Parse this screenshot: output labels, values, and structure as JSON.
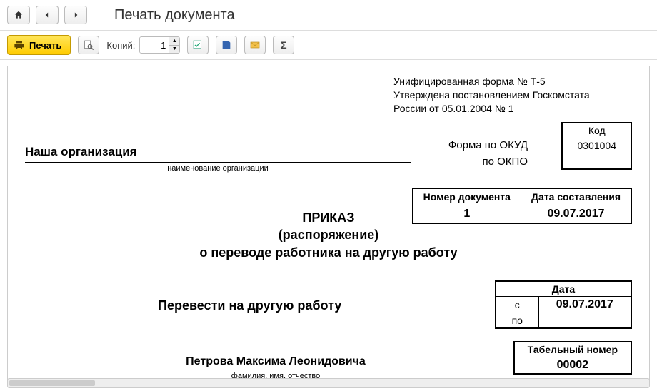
{
  "header": {
    "title": "Печать документа"
  },
  "toolbar": {
    "print_label": "Печать",
    "copies_label": "Копий:",
    "copies_value": "1"
  },
  "doc": {
    "approval_line1": "Унифицированная форма № Т-5",
    "approval_line2": "Утверждена постановлением Госкомстата",
    "approval_line3": "России от 05.01.2004 № 1",
    "kod_header": "Код",
    "okud": "0301004",
    "okpo": "",
    "form_okud_label": "Форма по ОКУД",
    "form_okpo_label": "по ОКПО",
    "org_name": "Наша организация",
    "org_caption": "наименование организации",
    "numdate": {
      "num_header": "Номер документа",
      "date_header": "Дата составления",
      "num": "1",
      "date": "09.07.2017"
    },
    "title_line1": "ПРИКАЗ",
    "title_line2": "(распоряжение)",
    "title_line3": "о переводе работника на другую работу",
    "transfer_label": "Перевести на другую работу",
    "date_table": {
      "header": "Дата",
      "from_label": "с",
      "from_value": "09.07.2017",
      "to_label": "по",
      "to_value": ""
    },
    "tabno": {
      "header": "Табельный номер",
      "value": "00002"
    },
    "fio": {
      "name": "Петрова Максима Леонидовича",
      "caption": "фамилия, имя, отчество"
    }
  }
}
